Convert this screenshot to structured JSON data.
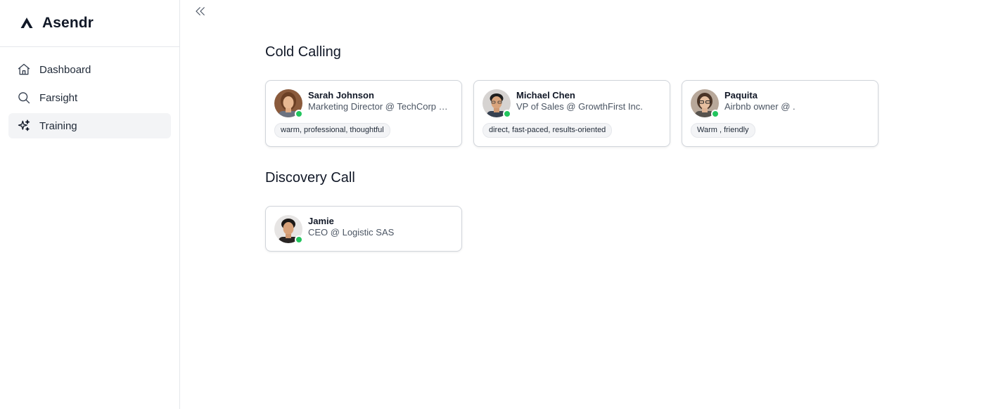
{
  "app": {
    "name": "Asendr"
  },
  "sidebar": {
    "items": [
      {
        "label": "Dashboard",
        "icon": "home-icon",
        "active": false
      },
      {
        "label": "Farsight",
        "icon": "search-icon",
        "active": false
      },
      {
        "label": "Training",
        "icon": "sparkles-icon",
        "active": true
      }
    ]
  },
  "toolbar": {
    "collapse_icon": "chevrons-left-icon"
  },
  "sections": [
    {
      "title": "Cold Calling",
      "personas": [
        {
          "name": "Sarah Johnson",
          "role": "Marketing Director @ TechCorp Solutions",
          "traits": "warm, professional, thoughtful",
          "status": "online"
        },
        {
          "name": "Michael Chen",
          "role": "VP of Sales @ GrowthFirst Inc.",
          "traits": "direct, fast-paced, results-oriented",
          "status": "online"
        },
        {
          "name": "Paquita",
          "role": "Airbnb owner @ .",
          "traits": "Warm , friendly",
          "status": "online"
        }
      ]
    },
    {
      "title": "Discovery Call",
      "personas": [
        {
          "name": "Jamie",
          "role": "CEO @ Logistic SAS",
          "status": "online"
        }
      ]
    }
  ],
  "colors": {
    "online": "#22c55e",
    "active_nav_bg": "#f3f4f6",
    "border": "#e5e7eb"
  }
}
